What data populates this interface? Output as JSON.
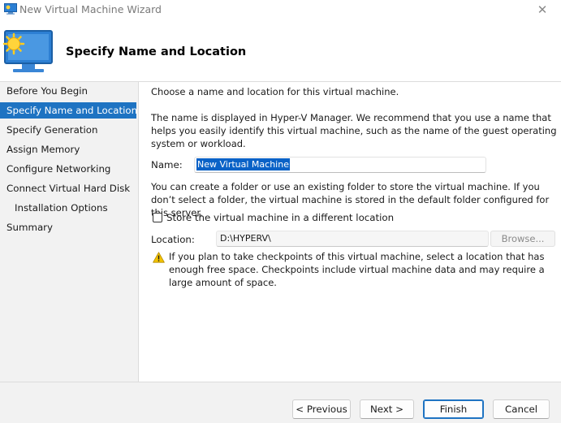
{
  "window": {
    "title": "New Virtual Machine Wizard",
    "close_glyph": "✕"
  },
  "header": {
    "title": "Specify Name and Location",
    "icon": "virtual-machine-icon"
  },
  "sidebar": {
    "items": [
      {
        "label": "Before You Begin",
        "active": false
      },
      {
        "label": "Specify Name and Location",
        "active": true
      },
      {
        "label": "Specify Generation",
        "active": false
      },
      {
        "label": "Assign Memory",
        "active": false
      },
      {
        "label": "Configure Networking",
        "active": false
      },
      {
        "label": "Connect Virtual Hard Disk",
        "active": false
      },
      {
        "label": "Installation Options",
        "active": false
      },
      {
        "label": "Summary",
        "active": false
      }
    ]
  },
  "main": {
    "intro": "Choose a name and location for this virtual machine.",
    "description": "The name is displayed in Hyper-V Manager. We recommend that you use a name that helps you easily identify this virtual machine, such as the name of the guest operating system or workload.",
    "name_label": "Name:",
    "name_value": "New Virtual Machine",
    "folder_info": "You can create a folder or use an existing folder to store the virtual machine. If you don’t select a folder, the virtual machine is stored in the default folder configured for this server.",
    "checkbox_label": "Store the virtual machine in a different location",
    "checkbox_checked": false,
    "location_label": "Location:",
    "location_value": "D:\\HYPERV\\",
    "browse_label": "Browse...",
    "warning_text": "If you plan to take checkpoints of this virtual machine, select a location that has enough free space. Checkpoints include virtual machine data and may require a large amount of space."
  },
  "footer": {
    "previous_label": "< Previous",
    "next_label": "Next >",
    "finish_label": "Finish",
    "cancel_label": "Cancel"
  },
  "colors": {
    "accent": "#1e73c2",
    "sidebar_bg": "#f2f2f2",
    "warning": "#f2c200"
  }
}
